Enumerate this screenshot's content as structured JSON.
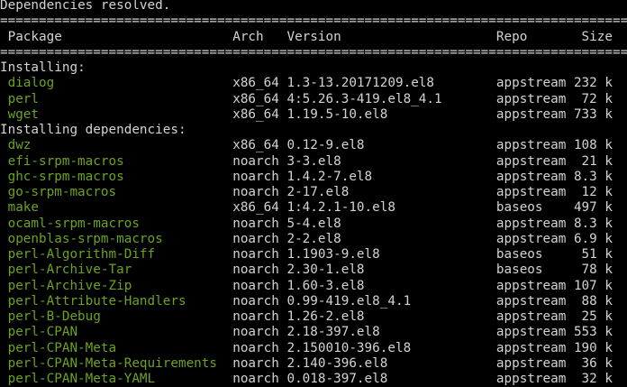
{
  "status": "Dependencies resolved.",
  "separator": "=================================================================================",
  "header": {
    "package": "Package",
    "arch": "Arch",
    "version": "Version",
    "repo": "Repo",
    "size": "Size"
  },
  "colors": {
    "package_name": "#6ba31c",
    "text": "#d3d3d3",
    "background": "#000000"
  },
  "sections": [
    {
      "title": "Installing:",
      "rows": [
        {
          "package": "dialog",
          "arch": "x86_64",
          "version": "1.3-13.20171209.el8",
          "repo": "appstream",
          "size": "232 k"
        },
        {
          "package": "perl",
          "arch": "x86_64",
          "version": "4:5.26.3-419.el8_4.1",
          "repo": "appstream",
          "size": "72 k"
        },
        {
          "package": "wget",
          "arch": "x86_64",
          "version": "1.19.5-10.el8",
          "repo": "appstream",
          "size": "733 k"
        }
      ]
    },
    {
      "title": "Installing dependencies:",
      "rows": [
        {
          "package": "dwz",
          "arch": "x86_64",
          "version": "0.12-9.el8",
          "repo": "appstream",
          "size": "108 k"
        },
        {
          "package": "efi-srpm-macros",
          "arch": "noarch",
          "version": "3-3.el8",
          "repo": "appstream",
          "size": "21 k"
        },
        {
          "package": "ghc-srpm-macros",
          "arch": "noarch",
          "version": "1.4.2-7.el8",
          "repo": "appstream",
          "size": "8.3 k"
        },
        {
          "package": "go-srpm-macros",
          "arch": "noarch",
          "version": "2-17.el8",
          "repo": "appstream",
          "size": "12 k"
        },
        {
          "package": "make",
          "arch": "x86_64",
          "version": "1:4.2.1-10.el8",
          "repo": "baseos",
          "size": "497 k"
        },
        {
          "package": "ocaml-srpm-macros",
          "arch": "noarch",
          "version": "5-4.el8",
          "repo": "appstream",
          "size": "8.3 k"
        },
        {
          "package": "openblas-srpm-macros",
          "arch": "noarch",
          "version": "2-2.el8",
          "repo": "appstream",
          "size": "6.9 k"
        },
        {
          "package": "perl-Algorithm-Diff",
          "arch": "noarch",
          "version": "1.1903-9.el8",
          "repo": "baseos",
          "size": "51 k"
        },
        {
          "package": "perl-Archive-Tar",
          "arch": "noarch",
          "version": "2.30-1.el8",
          "repo": "baseos",
          "size": "78 k"
        },
        {
          "package": "perl-Archive-Zip",
          "arch": "noarch",
          "version": "1.60-3.el8",
          "repo": "appstream",
          "size": "107 k"
        },
        {
          "package": "perl-Attribute-Handlers",
          "arch": "noarch",
          "version": "0.99-419.el8_4.1",
          "repo": "appstream",
          "size": "88 k"
        },
        {
          "package": "perl-B-Debug",
          "arch": "noarch",
          "version": "1.26-2.el8",
          "repo": "appstream",
          "size": "25 k"
        },
        {
          "package": "perl-CPAN",
          "arch": "noarch",
          "version": "2.18-397.el8",
          "repo": "appstream",
          "size": "553 k"
        },
        {
          "package": "perl-CPAN-Meta",
          "arch": "noarch",
          "version": "2.150010-396.el8",
          "repo": "appstream",
          "size": "190 k"
        },
        {
          "package": "perl-CPAN-Meta-Requirements",
          "arch": "noarch",
          "version": "2.140-396.el8",
          "repo": "appstream",
          "size": "36 k"
        },
        {
          "package": "perl-CPAN-Meta-YAML",
          "arch": "noarch",
          "version": "0.018-397.el8",
          "repo": "appstream",
          "size": "32 k"
        }
      ]
    }
  ]
}
